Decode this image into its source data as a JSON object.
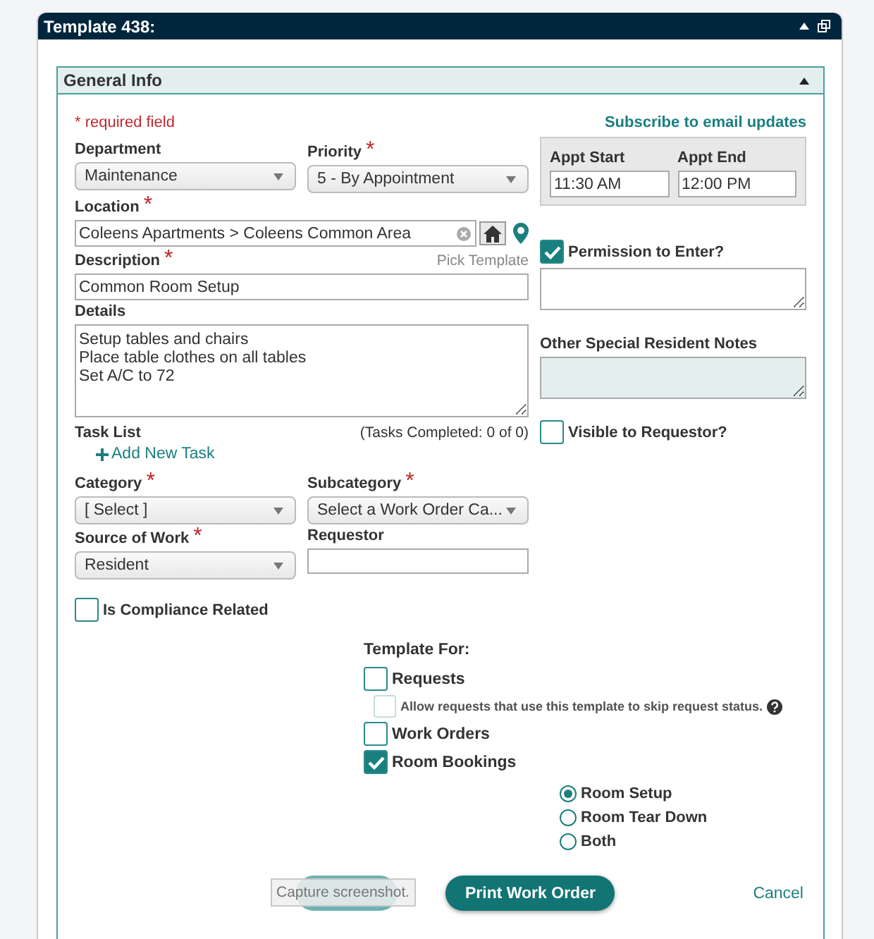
{
  "window": {
    "title": "Template 438:"
  },
  "section": {
    "title": "General Info",
    "expanded": true
  },
  "required_note": "* required field",
  "department": {
    "label": "Department",
    "value": "Maintenance"
  },
  "priority": {
    "label": "Priority",
    "marker": "*",
    "value": "5 - By Appointment"
  },
  "subscribe_link": "Subscribe to email updates",
  "appointment": [
    {
      "label": "Appt Start",
      "value": "11:30 AM"
    },
    {
      "label": "Appt End",
      "value": "12:00 PM"
    }
  ],
  "location": {
    "label": "Location",
    "marker": "*",
    "value": "Coleens Apartments > Coleens Common Area"
  },
  "description": {
    "label": "Description",
    "marker": "*",
    "value": "Common Room Setup",
    "pick_template": "Pick Template"
  },
  "details": {
    "label": "Details",
    "lines": [
      "Setup tables and chairs",
      "Place table clothes on all tables",
      "Set A/C to 72"
    ]
  },
  "permission": {
    "label": "Permission to Enter?",
    "checked": true
  },
  "resident_notes": {
    "label": "Other Special Resident Notes"
  },
  "task_list": {
    "label": "Task List",
    "completed": "(Tasks Completed: 0 of 0)",
    "add": "Add New Task"
  },
  "visible_to_requestor": {
    "label": "Visible to Requestor?",
    "checked": false
  },
  "category": {
    "label": "Category",
    "marker": "*",
    "value": "[ Select ]"
  },
  "subcategory": {
    "label": "Subcategory",
    "marker": "*",
    "value": "Select a Work Order Ca..."
  },
  "source_of_work": {
    "label": "Source of Work",
    "marker": "*",
    "value": "Resident"
  },
  "requestor": {
    "label": "Requestor"
  },
  "compliance": {
    "label": "Is Compliance Related",
    "checked": false
  },
  "template_for": {
    "label": "Template For:",
    "options": [
      {
        "kind": "main",
        "label": "Requests",
        "checked": false,
        "disabled": false
      },
      {
        "kind": "sub",
        "label": "Allow requests that use this template to skip request status.",
        "checked": false,
        "disabled": true
      },
      {
        "kind": "main",
        "label": "Work Orders",
        "checked": false,
        "disabled": false
      },
      {
        "kind": "main",
        "label": "Room Bookings",
        "checked": true,
        "disabled": false
      }
    ]
  },
  "booking_type": [
    {
      "label": "Room Setup",
      "selected": true
    },
    {
      "label": "Room Tear Down",
      "selected": false
    },
    {
      "label": "Both",
      "selected": false
    }
  ],
  "buttons": {
    "print": "Print Work Order",
    "cancel": "Cancel"
  },
  "tooltip": "Capture screenshot."
}
